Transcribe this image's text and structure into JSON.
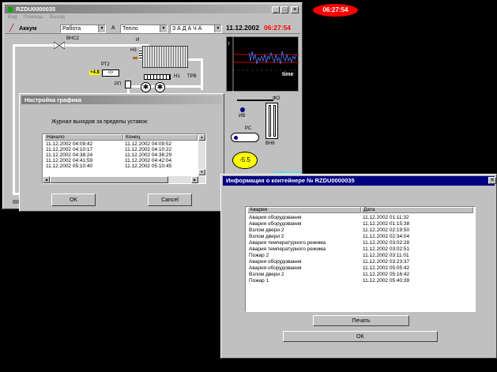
{
  "clock": "06:27:54",
  "main_window": {
    "title": "RZDU0000035",
    "menu": [
      "Вид",
      "Помощь",
      "Выход"
    ],
    "toolbar": {
      "mode_label": "Аккум",
      "mode_select": "Работа",
      "a_label": "А",
      "heat_select": "Тепло",
      "task_select": "З А Д А Ч А",
      "date": "11.12.2002",
      "time": "06:27:54"
    },
    "schema": {
      "vns2": "ВНС2",
      "i": "И",
      "n3": "Н3",
      "rt2": "РТ2",
      "rt2_value": "+4.8",
      "n1": "Н1",
      "trv": "ТРВ",
      "rp": "РП",
      "fo": "ФО",
      "iv": "ИВ",
      "rs": "РС",
      "vn6": "ВН6",
      "temp_value": "-5.5"
    },
    "graph": {
      "time_label": "time",
      "top_label": "t"
    }
  },
  "dialog_graph": {
    "title": "Настройка графика",
    "heading": "Журнал выходов за пределы уставок:",
    "columns": [
      "Начало",
      "Конец"
    ],
    "rows": [
      [
        "11.12.2002 04:09:42",
        "11.12.2002 04:09:52"
      ],
      [
        "11.12.2002 04:10:17",
        "11.12.2002 04:10:22"
      ],
      [
        "11.12.2002 04:38:24",
        "11.12.2002 04:38:29"
      ],
      [
        "11.12.2002 04:41:59",
        "11.12.2002 04:42:04"
      ],
      [
        "11.12.2002 05:10:40",
        "11.12.2002 05:10:45"
      ]
    ],
    "ok_label": "OK",
    "cancel_label": "Cancel"
  },
  "dialog_info": {
    "title": "Информация о контейнере № RZDU0000035",
    "columns": [
      "Авария",
      "Дата"
    ],
    "rows": [
      [
        "Авария оборудования",
        "11.12.2002 01:11:32"
      ],
      [
        "Авария оборудования",
        "11.12.2002 01:15:38"
      ],
      [
        "Взлом двери 2",
        "11.12.2002 02:19:50"
      ],
      [
        "Взлом двери 2",
        "11.12.2002 02:34:04"
      ],
      [
        "Авария температурного режима",
        "11.12.2002 03:02:28"
      ],
      [
        "Авария температурного режима",
        "11.12.2002 03:02:51"
      ],
      [
        "Пожар 2",
        "11.12.2002 03:11:01"
      ],
      [
        "Авария оборудования",
        "11.12.2002 03:23:37"
      ],
      [
        "Авария оборудования",
        "11.12.2002 05:05:42"
      ],
      [
        "Взлом двери 2",
        "11.12.2002 05:16:42"
      ],
      [
        "Пожар 1",
        "11.12.2002 05:40:39"
      ]
    ],
    "print_label": "Печать",
    "ok_label": "OK"
  },
  "colors": {
    "clock_bg": "#ff0000",
    "time_text": "#ff0000",
    "accent_yellow": "#ffff00",
    "titlebar_active": "#000080"
  }
}
